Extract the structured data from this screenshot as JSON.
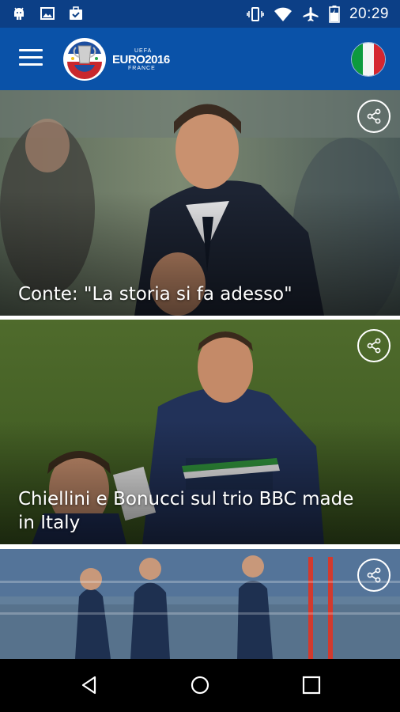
{
  "status_bar": {
    "time": "20:29",
    "left_icons": [
      "android-icon",
      "image-icon",
      "briefcase-check-icon"
    ],
    "right_icons": [
      "vibrate-icon",
      "wifi-icon",
      "airplane-icon",
      "battery-charging-icon"
    ]
  },
  "app_bar": {
    "logo": {
      "uefa": "UEFA",
      "euro": "EURO2016",
      "country": "FRANCE"
    },
    "flag": "italy-flag"
  },
  "feed": {
    "cards": [
      {
        "title": "Conte: \"La storia si fa adesso\""
      },
      {
        "title": "Chiellini e Bonucci sul trio BBC made in Italy"
      },
      {
        "title": ""
      }
    ]
  },
  "colors": {
    "status_bar": "#0c3f86",
    "app_bar": "#0a52a8",
    "flag_green": "#0d9a3e",
    "flag_white": "#f4f4f4",
    "flag_red": "#d5262f"
  }
}
